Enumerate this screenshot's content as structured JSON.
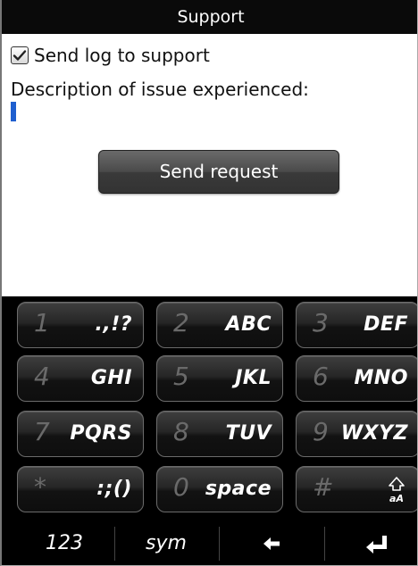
{
  "title": "Support",
  "form": {
    "checkbox_label": "Send log to support",
    "checkbox_checked": true,
    "description_label": "Description of issue experienced:",
    "description_value": "",
    "send_button": "Send request"
  },
  "keyboard": {
    "keys": [
      {
        "num": "1",
        "letters": ".,!?"
      },
      {
        "num": "2",
        "letters": "ABC"
      },
      {
        "num": "3",
        "letters": "DEF"
      },
      {
        "num": "4",
        "letters": "GHI"
      },
      {
        "num": "5",
        "letters": "JKL"
      },
      {
        "num": "6",
        "letters": "MNO"
      },
      {
        "num": "7",
        "letters": "PQRS"
      },
      {
        "num": "8",
        "letters": "TUV"
      },
      {
        "num": "9",
        "letters": "WXYZ"
      },
      {
        "num": "*",
        "letters": ":;()"
      },
      {
        "num": "0",
        "letters": "space"
      },
      {
        "num": "#",
        "letters": "",
        "icon": "shift-aA-icon"
      }
    ],
    "bottom": {
      "numbers": "123",
      "symbols": "sym",
      "backspace_icon": "backspace-arrow-icon",
      "enter_icon": "enter-arrow-icon"
    }
  },
  "colors": {
    "titlebar_bg": "#0a0a0a",
    "cursor": "#1f5fcf",
    "key_bg": "#1a1a1a"
  }
}
